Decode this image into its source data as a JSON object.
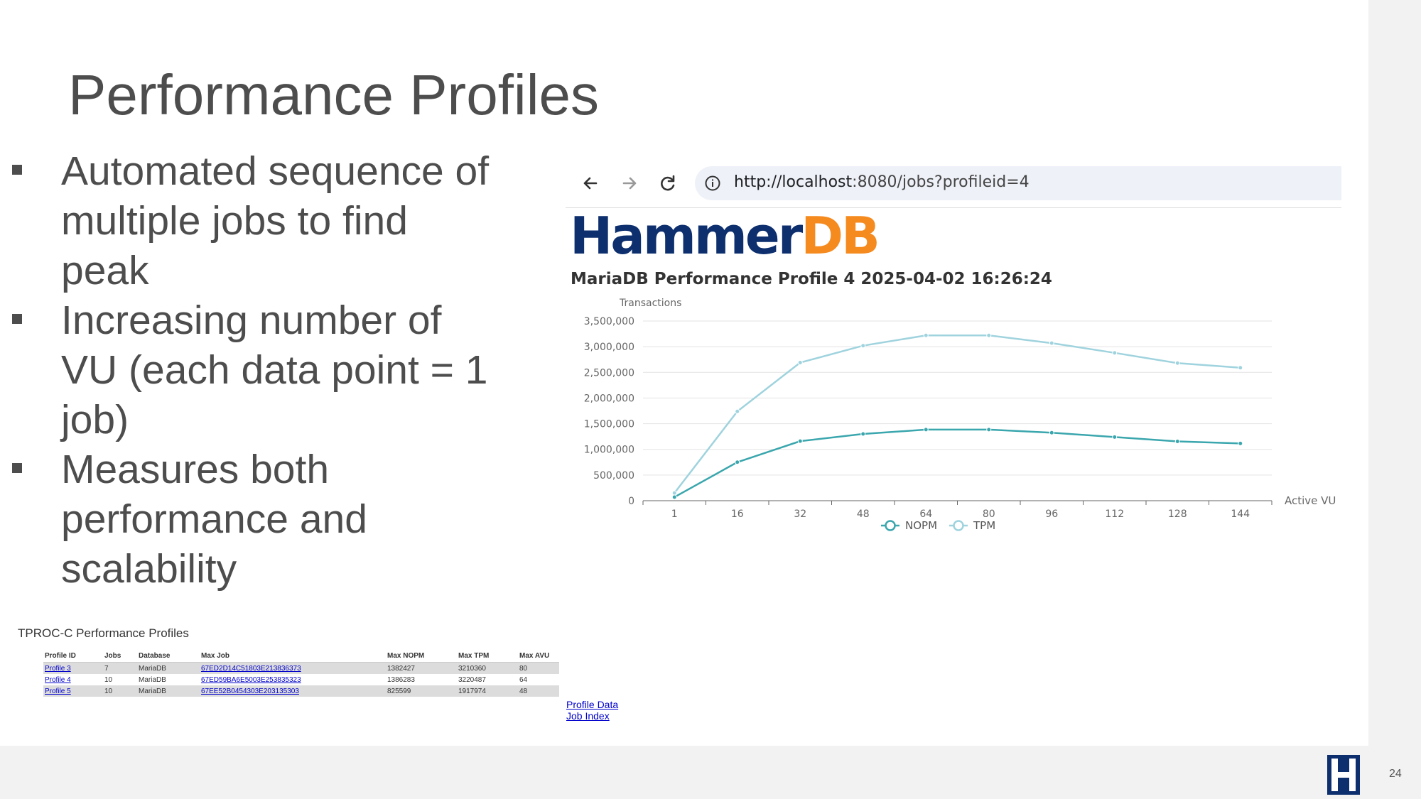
{
  "slide": {
    "title": "Performance Profiles",
    "bullets": [
      [
        "Automated sequence of",
        "multiple jobs to find",
        "peak"
      ],
      [
        "Increasing number of",
        "VU (each data point = 1",
        "job)"
      ],
      [
        "Measures both",
        "performance and",
        "scalability"
      ]
    ],
    "page_number": "24"
  },
  "browser": {
    "url_host": "http://localhost",
    "url_rest": ":8080/jobs?profileid=4",
    "back_icon": "arrow-left-icon",
    "forward_icon": "arrow-right-icon",
    "reload_icon": "reload-icon",
    "info_icon": "info-icon"
  },
  "logo": {
    "part1": "Hammer",
    "part2": "DB"
  },
  "chart_heading": "MariaDB Performance Profile 4 2025-04-02 16:26:24",
  "chart_data": {
    "type": "line",
    "ylabel": "Transactions",
    "xlabel": "Active VU",
    "categories": [
      "1",
      "16",
      "32",
      "48",
      "64",
      "80",
      "96",
      "112",
      "128",
      "144"
    ],
    "ylim": [
      0,
      3500000
    ],
    "y_ticks": [
      "0",
      "500,000",
      "1,000,000",
      "1,500,000",
      "2,000,000",
      "2,500,000",
      "3,000,000",
      "3,500,000"
    ],
    "grid": true,
    "legend_position": "bottom",
    "series": [
      {
        "name": "NOPM",
        "color": "#3aa6ad",
        "values": [
          70000,
          750000,
          1160000,
          1300000,
          1385000,
          1385000,
          1325000,
          1240000,
          1155000,
          1115000
        ]
      },
      {
        "name": "TPM",
        "color": "#9fd3de",
        "values": [
          150000,
          1740000,
          2690000,
          3020000,
          3220000,
          3220000,
          3070000,
          2880000,
          2680000,
          2590000
        ]
      }
    ]
  },
  "profiles_table": {
    "title": "TPROC-C Performance Profiles",
    "headers": [
      "Profile ID",
      "Jobs",
      "Database",
      "Max Job",
      "Max NOPM",
      "Max TPM",
      "Max AVU"
    ],
    "rows": [
      [
        "Profile 3",
        "7",
        "MariaDB",
        "67ED2D14C51803E213836373",
        "1382427",
        "3210360",
        "80"
      ],
      [
        "Profile 4",
        "10",
        "MariaDB",
        "67ED59BA6E5003E253835323",
        "1386283",
        "3220487",
        "64"
      ],
      [
        "Profile 5",
        "10",
        "MariaDB",
        "67EE52B0454303E203135303",
        "825599",
        "1917974",
        "48"
      ]
    ]
  },
  "links": [
    "Profile Data",
    "Job Index"
  ]
}
